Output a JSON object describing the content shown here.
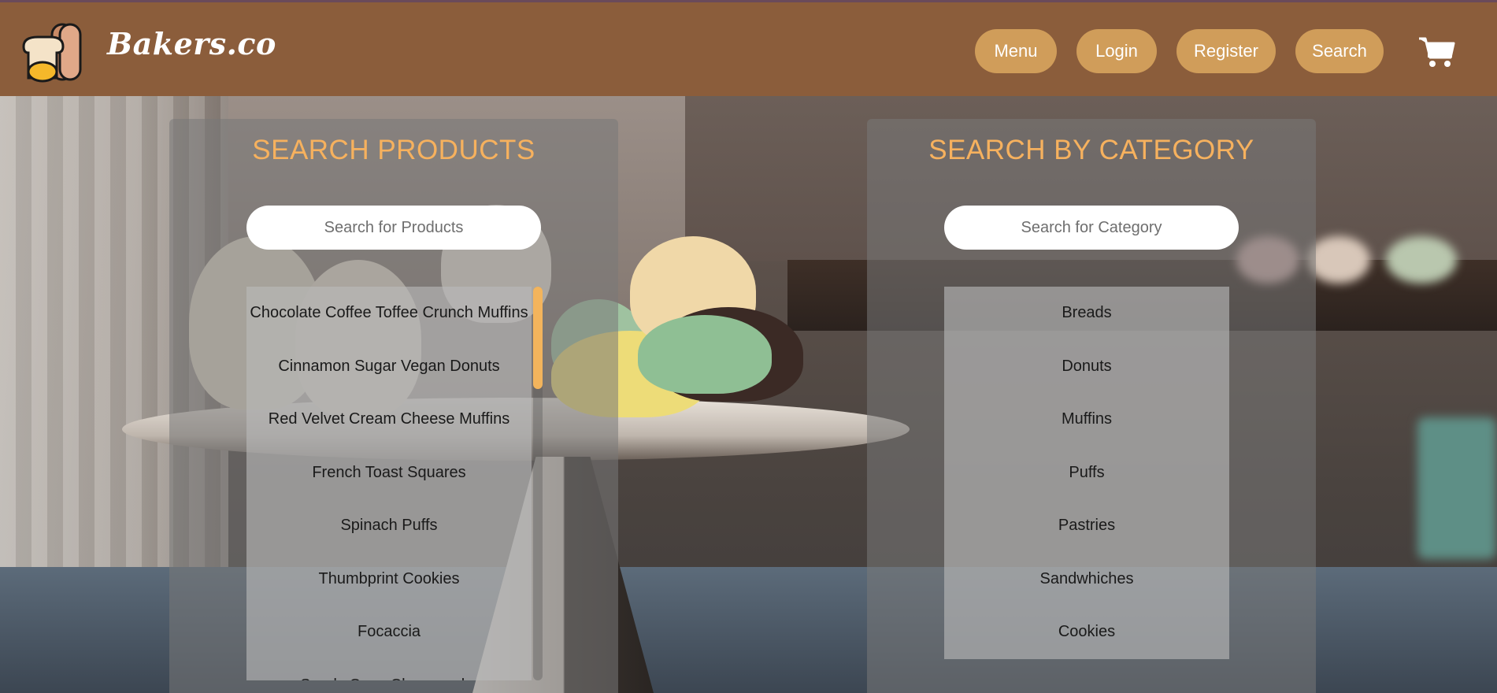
{
  "header": {
    "brand": "Bakers.co",
    "logo_icon": "bread-loaf-logo-icon",
    "nav": [
      {
        "label": "Menu"
      },
      {
        "label": "Login"
      },
      {
        "label": "Register"
      },
      {
        "label": "Search"
      }
    ],
    "cart_icon": "shopping-cart-icon"
  },
  "products_panel": {
    "title": "SEARCH PRODUCTS",
    "search_placeholder": "Search for Products",
    "items": [
      "Chocolate Coffee Toffee Crunch Muffins",
      "Cinnamon Sugar Vegan Donuts",
      "Red Velvet Cream Cheese Muffins",
      "French Toast Squares",
      "Spinach Puffs",
      "Thumbprint Cookies",
      "Focaccia",
      "Sandy Cove Cheesecake"
    ]
  },
  "category_panel": {
    "title": "SEARCH BY CATEGORY",
    "search_placeholder": "Search for Category",
    "items": [
      "Breads",
      "Donuts",
      "Muffins",
      "Puffs",
      "Pastries",
      "Sandwhiches",
      "Cookies"
    ]
  },
  "colors": {
    "header_bg": "#8b5d3b",
    "button_bg": "#d09d5a",
    "title_accent": "#f6b15e",
    "scroll_thumb": "#f3b45c"
  }
}
